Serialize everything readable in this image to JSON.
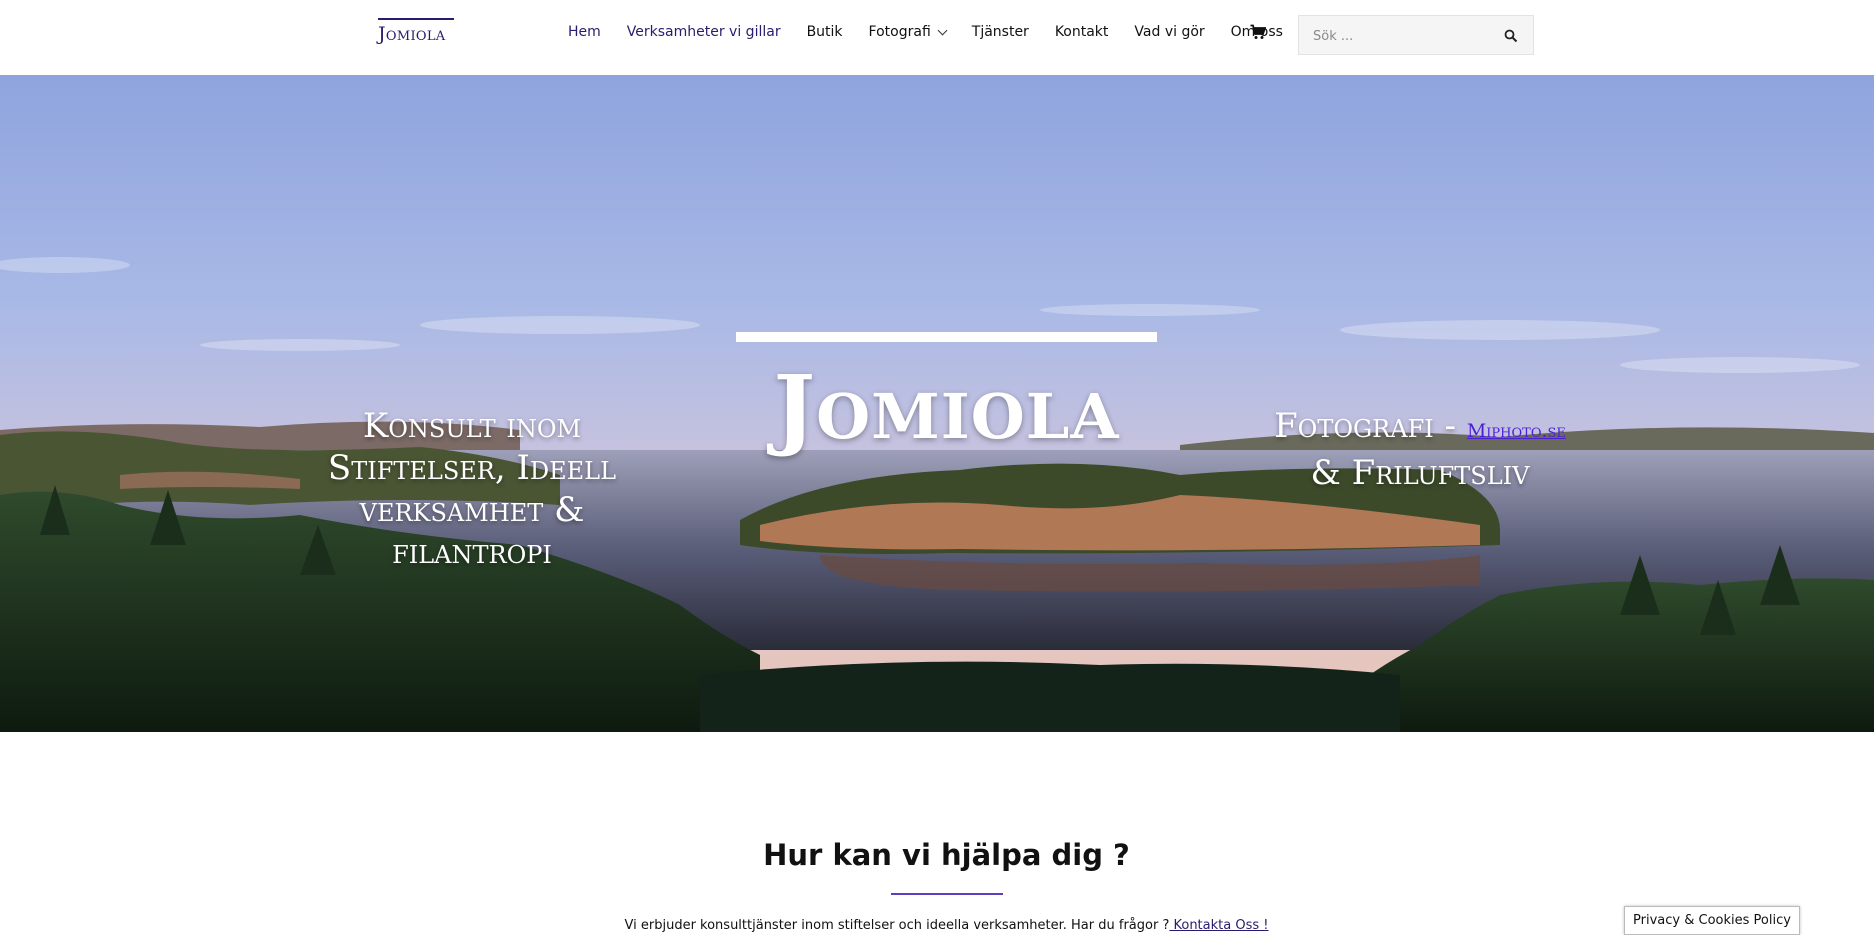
{
  "brand": {
    "logo_text": "Jomiola"
  },
  "nav": {
    "items": [
      {
        "label": "Hem",
        "active": true
      },
      {
        "label": "Verksamheter vi gillar",
        "active": true
      },
      {
        "label": "Butik",
        "active": false
      },
      {
        "label": "Fotografi",
        "active": false,
        "has_dropdown": true
      },
      {
        "label": "Tjänster",
        "active": false
      },
      {
        "label": "Kontakt",
        "active": false
      },
      {
        "label": "Vad vi gör",
        "active": false
      },
      {
        "label": "Om oss",
        "active": false
      }
    ],
    "cart_icon": "cart-icon"
  },
  "search": {
    "placeholder": "Sök ...",
    "icon": "search-icon"
  },
  "hero": {
    "title": "Jomiola",
    "left_text": "Konsult inom Stiftelser, Ideell verksamhet & filantropi",
    "right_text_prefix": "Fotografi - ",
    "right_link": "Miphoto.se",
    "right_text_suffix": "& Friluftsliv"
  },
  "section": {
    "title": "Hur kan vi hjälpa dig ?",
    "text": "Vi erbjuder konsulttjänster inom stiftelser och ideella verksamheter.  Har du frågor ?",
    "link": " Kontakta Oss ! "
  },
  "cookie_notice": {
    "label": "Privacy & Cookies Policy"
  },
  "colors": {
    "accent": "#2b1b6e",
    "link": "#4b1fd6",
    "rule": "#5b3fbf"
  }
}
